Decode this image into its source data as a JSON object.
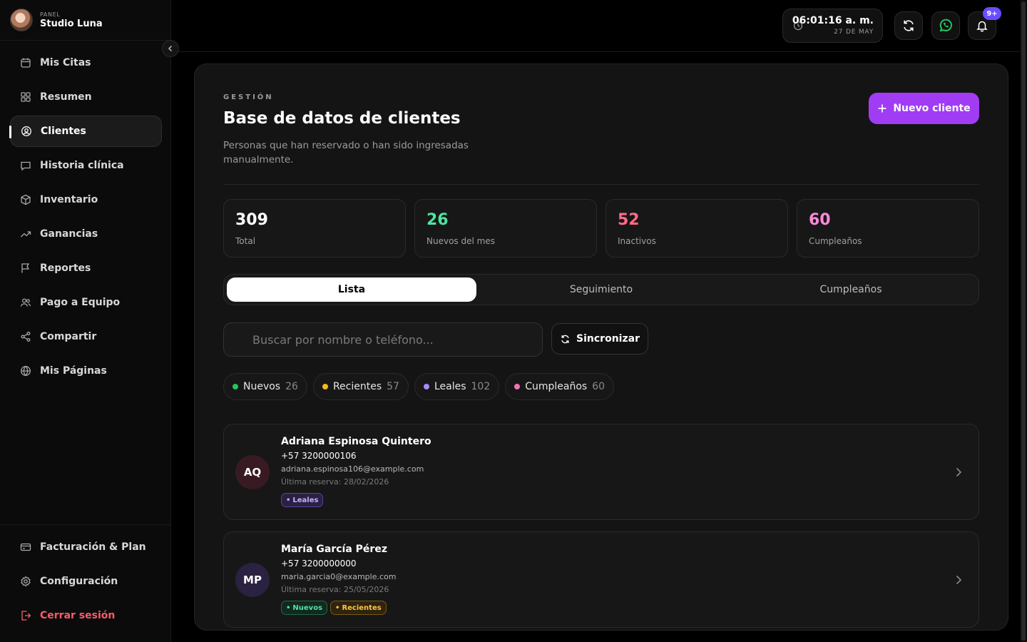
{
  "brand": {
    "small": "PANEL",
    "name": "Studio Luna"
  },
  "sidebar": {
    "items": [
      {
        "label": "Mis Citas",
        "icon": "calendar-icon"
      },
      {
        "label": "Resumen",
        "icon": "grid-icon"
      },
      {
        "label": "Clientes",
        "icon": "user-circle-icon",
        "active": true
      },
      {
        "label": "Historia clínica",
        "icon": "message-icon"
      },
      {
        "label": "Inventario",
        "icon": "box-icon"
      },
      {
        "label": "Ganancias",
        "icon": "trending-up-icon"
      },
      {
        "label": "Reportes",
        "icon": "flag-icon"
      },
      {
        "label": "Pago a Equipo",
        "icon": "users-icon"
      },
      {
        "label": "Compartir",
        "icon": "share-icon"
      },
      {
        "label": "Mis Páginas",
        "icon": "globe-icon"
      }
    ],
    "bottom": [
      {
        "label": "Facturación & Plan",
        "icon": "credit-card-icon"
      },
      {
        "label": "Configuración",
        "icon": "settings-icon"
      },
      {
        "label": "Cerrar sesión",
        "icon": "logout-icon"
      }
    ]
  },
  "header": {
    "time": "06:01:16 a. m.",
    "date": "27 DE MAY",
    "notifications_badge": "9+"
  },
  "main": {
    "eyebrow": "GESTIÓN",
    "title": "Base de datos de clientes",
    "subtitle": "Personas que han reservado o han sido ingresadas manualmente.",
    "new_button": "Nuevo cliente",
    "stats": [
      {
        "value": "309",
        "label": "Total",
        "color": "#ffffff"
      },
      {
        "value": "26",
        "label": "Nuevos del mes",
        "color": "#4fe3a0"
      },
      {
        "value": "52",
        "label": "Inactivos",
        "color": "#ff6b8a"
      },
      {
        "value": "60",
        "label": "Cumpleaños",
        "color": "#ff8ad8"
      }
    ],
    "tabs": [
      "Lista",
      "Seguimiento",
      "Cumpleaños"
    ],
    "search_placeholder": "Buscar por nombre o teléfono...",
    "sync_button": "Sincronizar",
    "filters": [
      {
        "label": "Nuevos",
        "count": "26",
        "color": "#22c55e"
      },
      {
        "label": "Recientes",
        "count": "57",
        "color": "#f5b820"
      },
      {
        "label": "Leales",
        "count": "102",
        "color": "#a78bfa"
      },
      {
        "label": "Cumpleaños",
        "count": "60",
        "color": "#f472b6"
      }
    ],
    "clients": [
      {
        "initials": "AQ",
        "avatar_color": "#3a1a22",
        "name": "Adriana Espinosa Quintero",
        "phone": "+57 3200000106",
        "email": "adriana.espinosa106@example.com",
        "last": "Última reserva: 28/02/2026",
        "tags": [
          {
            "label": "Leales",
            "kind": "leal"
          }
        ]
      },
      {
        "initials": "MP",
        "avatar_color": "#2a2240",
        "name": "María García Pérez",
        "phone": "+57 3200000000",
        "email": "maria.garcia0@example.com",
        "last": "Última reserva: 25/05/2026",
        "tags": [
          {
            "label": "Nuevos",
            "kind": "nuevo"
          },
          {
            "label": "Recientes",
            "kind": "reciente"
          }
        ]
      }
    ]
  }
}
